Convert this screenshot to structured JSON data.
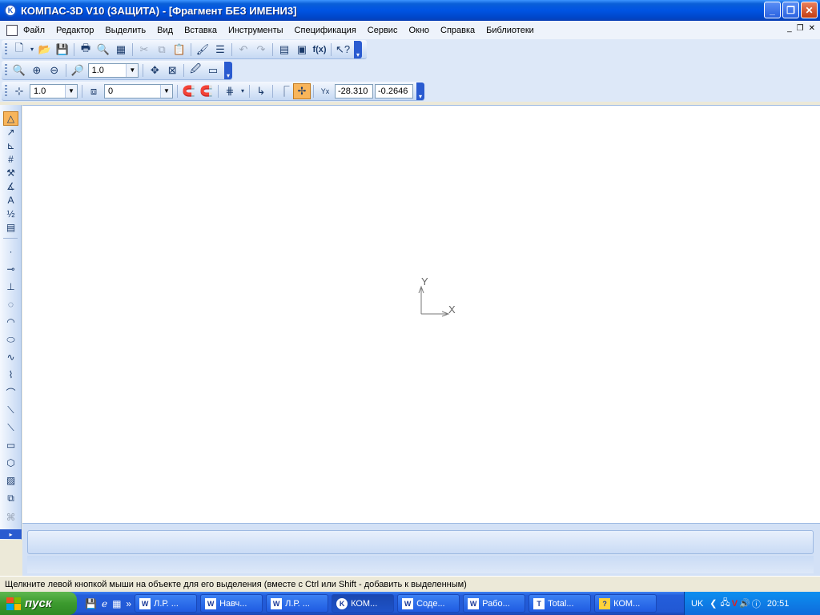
{
  "window": {
    "title": "КОМПАС-3D V10 (ЗАЩИТА) - [Фрагмент БЕЗ ИМЕНИ3]",
    "logo": "K"
  },
  "menu": [
    "Файл",
    "Редактор",
    "Выделить",
    "Вид",
    "Вставка",
    "Инструменты",
    "Спецификация",
    "Сервис",
    "Окно",
    "Справка",
    "Библиотеки"
  ],
  "toolbars": {
    "zoom_value": "1.0",
    "step_value": "1.0",
    "layer_value": "0",
    "coord_x": "-28.310",
    "coord_y": "-0.2646",
    "fx_label": "f(x)"
  },
  "canvas": {
    "axis_x": "X",
    "axis_y": "Y"
  },
  "status": {
    "message": "Щелкните левой кнопкой мыши на объекте для его выделения (вместе с Ctrl или Shift - добавить к выделенным)"
  },
  "taskbar": {
    "start_label": "пуск",
    "tasks": [
      {
        "label": "Л.Р. ...",
        "icon": "W"
      },
      {
        "label": "Навч...",
        "icon": "W"
      },
      {
        "label": "Л.Р. ...",
        "icon": "W"
      },
      {
        "label": "КОМ...",
        "icon": "K"
      },
      {
        "label": "Соде...",
        "icon": "W"
      },
      {
        "label": "Рабо...",
        "icon": "W"
      },
      {
        "label": "Total...",
        "icon": "T"
      },
      {
        "label": "КОМ...",
        "icon": "?"
      }
    ],
    "lang": "UK",
    "clock": "20:51"
  },
  "colors": {
    "accent": "#0054E3",
    "toolbar": "#C5D8F3",
    "active_tool": "#F8B55A",
    "start": "#3C9A2E"
  }
}
